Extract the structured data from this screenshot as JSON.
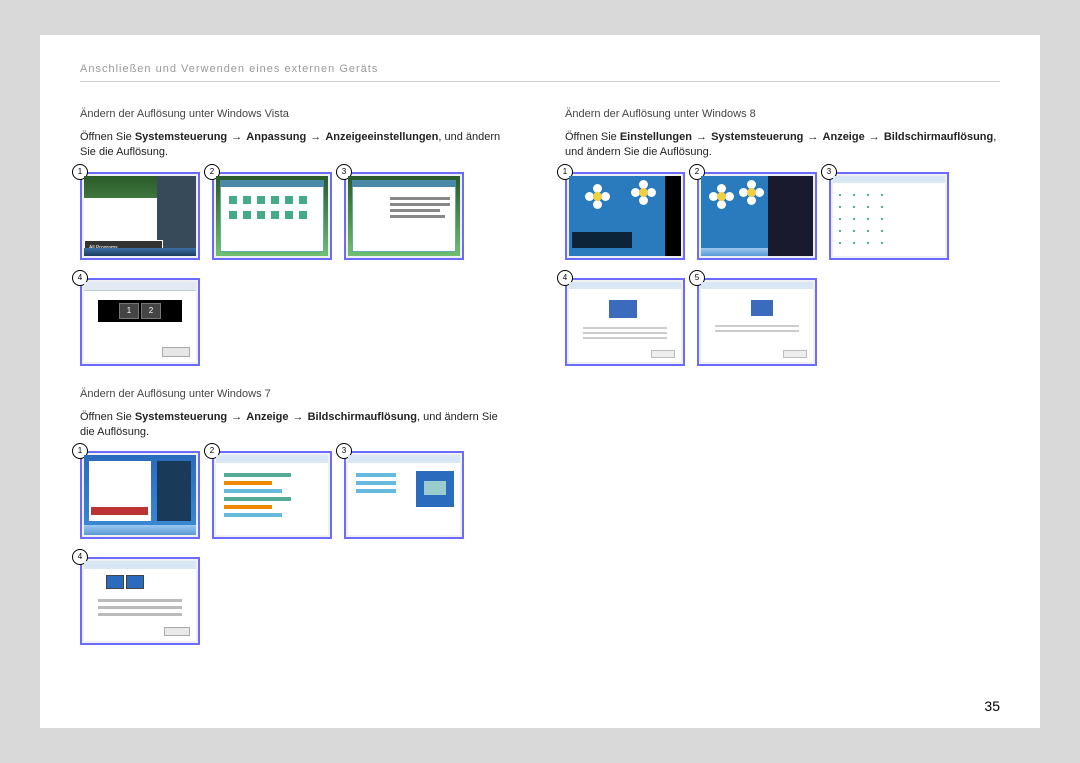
{
  "header": "Anschließen und Verwenden eines externen Geräts",
  "page_number": "35",
  "arrow": "→",
  "left": {
    "vista": {
      "title": "Ändern der Auflösung unter Windows Vista",
      "pre": "Öffnen Sie ",
      "b1": "Systemsteuerung",
      "b2": "Anpassung",
      "b3": "Anzeigeeinstellungen",
      "post": ", und ändern Sie die Auflösung.",
      "thumbs": [
        "1",
        "2",
        "3",
        "4"
      ]
    },
    "win7": {
      "title": "Ändern der Auflösung unter Windows 7",
      "pre": "Öffnen Sie ",
      "b1": "Systemsteuerung",
      "b2": "Anzeige",
      "b3": "Bildschirmauflösung",
      "post": ", und ändern Sie die Auflösung.",
      "thumbs": [
        "1",
        "2",
        "3",
        "4"
      ]
    }
  },
  "right": {
    "win8": {
      "title": "Ändern der Auflösung unter Windows 8",
      "pre": "Öffnen Sie ",
      "b1": "Einstellungen",
      "b2": "Systemsteuerung",
      "b3": "Anzeige",
      "b4": "Bildschirmauflösung",
      "post": ", und ändern Sie die Auflösung.",
      "thumbs": [
        "1",
        "2",
        "3",
        "4",
        "5"
      ]
    }
  },
  "misc": {
    "all_programs": "All Programs",
    "mon1": "1",
    "mon2": "2"
  }
}
